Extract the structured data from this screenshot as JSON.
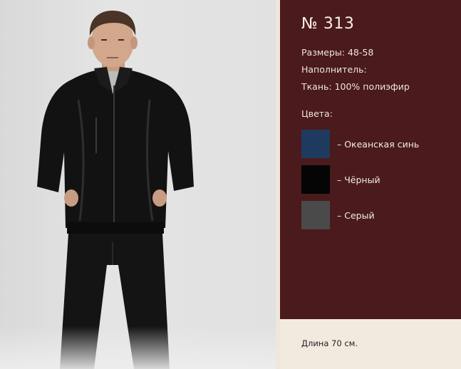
{
  "product": {
    "number": "№ 313",
    "specs": [
      {
        "text": "Размеры: 48-58"
      },
      {
        "text": "Наполнитель:"
      },
      {
        "text": "Ткань: 100% полиэфир"
      }
    ],
    "colors_heading": "Цвета:",
    "colors": [
      {
        "label": "– Океанская синь",
        "color": "#1f3a5f"
      },
      {
        "label": "– Чёрный",
        "color": "#050505"
      },
      {
        "label": "– Серый",
        "color": "#4a4a4a"
      }
    ],
    "length": "Длина 70 см."
  },
  "theme": {
    "panel_color": "#4a1a1c",
    "footer_color": "#f2eadf"
  }
}
